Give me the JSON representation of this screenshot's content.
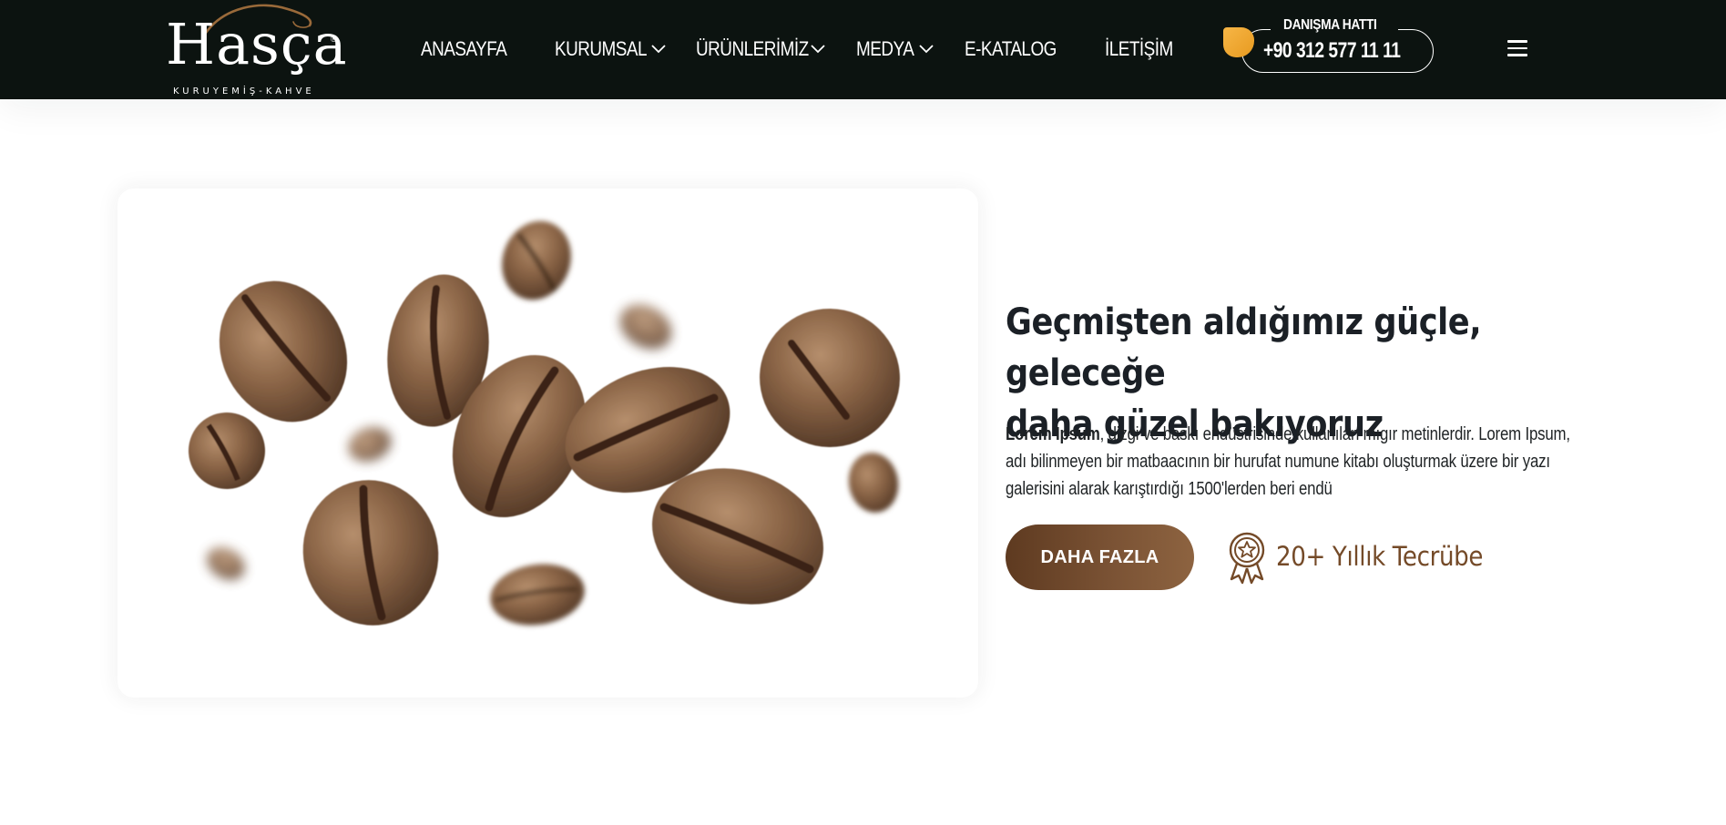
{
  "header": {
    "logo": {
      "name": "Hasça",
      "tagline": "KURUYEMİŞ-KAHVE",
      "reg_mark": "®"
    },
    "nav": [
      {
        "label": "ANASAYFA",
        "has_dropdown": false
      },
      {
        "label": "KURUMSAL",
        "has_dropdown": true
      },
      {
        "label": "ÜRÜNLERİMİZ",
        "has_dropdown": true
      },
      {
        "label": "MEDYA",
        "has_dropdown": true
      },
      {
        "label": "E-KATALOG",
        "has_dropdown": false
      },
      {
        "label": "İLETİŞİM",
        "has_dropdown": false
      }
    ],
    "hotline": {
      "label": "DANIŞMA HATTI",
      "number": "+90 312 577 11 11"
    },
    "menu_icon": "hamburger-icon"
  },
  "hero": {
    "image_icon": "coffee-beans-image",
    "headline_line1": "Geçmişten aldığımız güçle, geleceğe",
    "headline_line2": "daha güzel bakıyoruz",
    "desc_bold": "Lorem Ipsum",
    "desc_rest": ", dizgi ve baskı endüstrisinde kullanılan mıgır metinlerdir. Lorem Ipsum, adı bilinmeyen bir matbaacının bir hurufat numune kitabı oluşturmak üzere bir yazı galerisini alarak karıştırdığı 1500'lerden beri endü",
    "cta_label": "DAHA FAZLA",
    "experience_label": "20+ Yıllık Tecrübe",
    "experience_icon": "award-badge-icon"
  },
  "colors": {
    "header_bg": "#0c1310",
    "accent_brown": "#744a28",
    "accent_gold": "#f0a83a",
    "text_dark": "#1b2026"
  }
}
